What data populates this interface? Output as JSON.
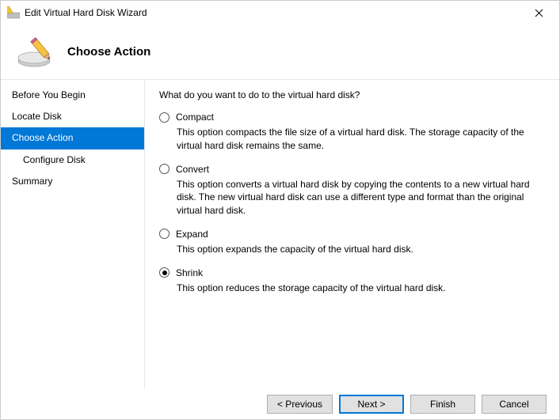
{
  "window": {
    "title": "Edit Virtual Hard Disk Wizard"
  },
  "header": {
    "page_title": "Choose Action"
  },
  "sidebar": {
    "items": [
      {
        "label": "Before You Begin",
        "active": false,
        "indent": false
      },
      {
        "label": "Locate Disk",
        "active": false,
        "indent": false
      },
      {
        "label": "Choose Action",
        "active": true,
        "indent": false
      },
      {
        "label": "Configure Disk",
        "active": false,
        "indent": true
      },
      {
        "label": "Summary",
        "active": false,
        "indent": false
      }
    ]
  },
  "content": {
    "question": "What do you want to do to the virtual hard disk?",
    "options": [
      {
        "key": "compact",
        "label": "Compact",
        "description": "This option compacts the file size of a virtual hard disk. The storage capacity of the virtual hard disk remains the same.",
        "selected": false
      },
      {
        "key": "convert",
        "label": "Convert",
        "description": "This option converts a virtual hard disk by copying the contents to a new virtual hard disk. The new virtual hard disk can use a different type and format than the original virtual hard disk.",
        "selected": false
      },
      {
        "key": "expand",
        "label": "Expand",
        "description": "This option expands the capacity of the virtual hard disk.",
        "selected": false
      },
      {
        "key": "shrink",
        "label": "Shrink",
        "description": "This option reduces the storage capacity of the virtual hard disk.",
        "selected": true
      }
    ]
  },
  "footer": {
    "previous": "< Previous",
    "next": "Next >",
    "finish": "Finish",
    "cancel": "Cancel"
  }
}
